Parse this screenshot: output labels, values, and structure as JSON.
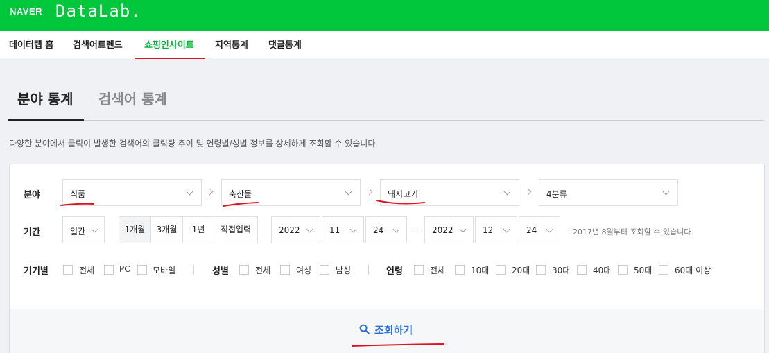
{
  "header": {
    "logo_naver": "NAVER",
    "logo_datalab": "DataLab."
  },
  "nav": {
    "items": [
      {
        "label": "데이터랩 홈"
      },
      {
        "label": "검색어트렌드"
      },
      {
        "label": "쇼핑인사이트",
        "active": true
      },
      {
        "label": "지역통계"
      },
      {
        "label": "댓글통계"
      }
    ]
  },
  "tabs": [
    {
      "label": "분야 통계",
      "active": true
    },
    {
      "label": "검색어 통계",
      "active": false
    }
  ],
  "description": "다양한 분야에서 클릭이 발생한 검색어의 클릭량 추이 및 연령별/성별 정보를 상세하게 조회할 수 있습니다.",
  "category": {
    "label": "분야",
    "level1": "식품",
    "level2": "축산물",
    "level3": "돼지고기",
    "level4": "4분류"
  },
  "period": {
    "label": "기간",
    "unit": "일간",
    "range_buttons": [
      "1개월",
      "3개월",
      "1년",
      "직접입력"
    ],
    "selected_range": "1개월",
    "start": {
      "year": "2022",
      "month": "11",
      "day": "24"
    },
    "end": {
      "year": "2022",
      "month": "12",
      "day": "24"
    },
    "note": "· 2017년 8월부터 조회할 수 있습니다."
  },
  "filters": {
    "device": {
      "label": "기기별",
      "options": [
        "전체",
        "PC",
        "모바일"
      ]
    },
    "gender": {
      "label": "성별",
      "options": [
        "전체",
        "여성",
        "남성"
      ]
    },
    "age": {
      "label": "연령",
      "options": [
        "전체",
        "10대",
        "20대",
        "30대",
        "40대",
        "50대",
        "60대 이상"
      ]
    }
  },
  "search_button": {
    "label": "조회하기",
    "icon": "search-icon"
  },
  "colors": {
    "brand": "#00c73c",
    "active_nav": "#00b33c",
    "link": "#2f6fd6",
    "annotation": "#e0141e"
  }
}
